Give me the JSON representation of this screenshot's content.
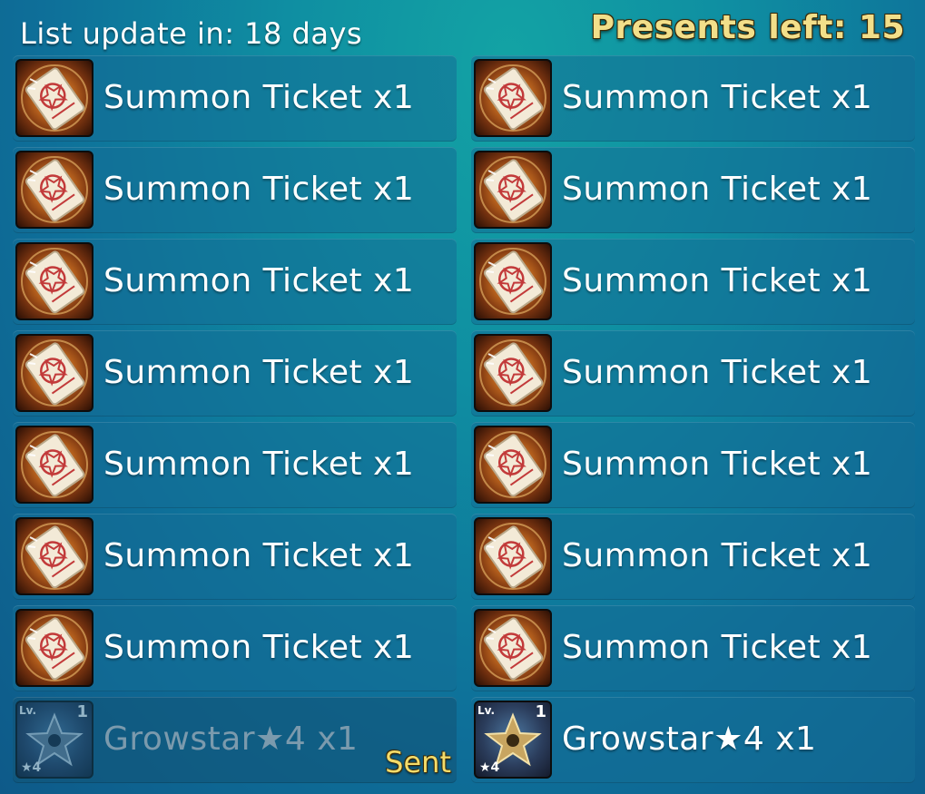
{
  "header": {
    "list_update": "List update in: 18 days",
    "presents_left": "Presents left: 15"
  },
  "colors": {
    "accent_gold": "#f2df8a",
    "panel": "#146e96",
    "sent_tag": "#f4dc6a"
  },
  "items": [
    {
      "label": "Summon Ticket  x1",
      "icon": "summon-ticket-icon"
    },
    {
      "label": "Summon Ticket  x1",
      "icon": "summon-ticket-icon"
    },
    {
      "label": "Summon Ticket  x1",
      "icon": "summon-ticket-icon"
    },
    {
      "label": "Summon Ticket  x1",
      "icon": "summon-ticket-icon"
    },
    {
      "label": "Summon Ticket  x1",
      "icon": "summon-ticket-icon"
    },
    {
      "label": "Summon Ticket  x1",
      "icon": "summon-ticket-icon"
    },
    {
      "label": "Summon Ticket  x1",
      "icon": "summon-ticket-icon"
    },
    {
      "label": "Summon Ticket  x1",
      "icon": "summon-ticket-icon"
    },
    {
      "label": "Summon Ticket  x1",
      "icon": "summon-ticket-icon"
    },
    {
      "label": "Summon Ticket  x1",
      "icon": "summon-ticket-icon"
    },
    {
      "label": "Summon Ticket  x1",
      "icon": "summon-ticket-icon"
    },
    {
      "label": "Summon Ticket  x1",
      "icon": "summon-ticket-icon"
    },
    {
      "label": "Summon Ticket  x1",
      "icon": "summon-ticket-icon"
    },
    {
      "label": "Summon Ticket  x1",
      "icon": "summon-ticket-icon"
    },
    {
      "label": "Growstar★4  x1",
      "icon": "growstar-icon",
      "level_label": "Lv.",
      "level": "1",
      "stars": "★4",
      "status": "Sent"
    },
    {
      "label": "Growstar★4  x1",
      "icon": "growstar-icon",
      "level_label": "Lv.",
      "level": "1",
      "stars": "★4"
    }
  ]
}
